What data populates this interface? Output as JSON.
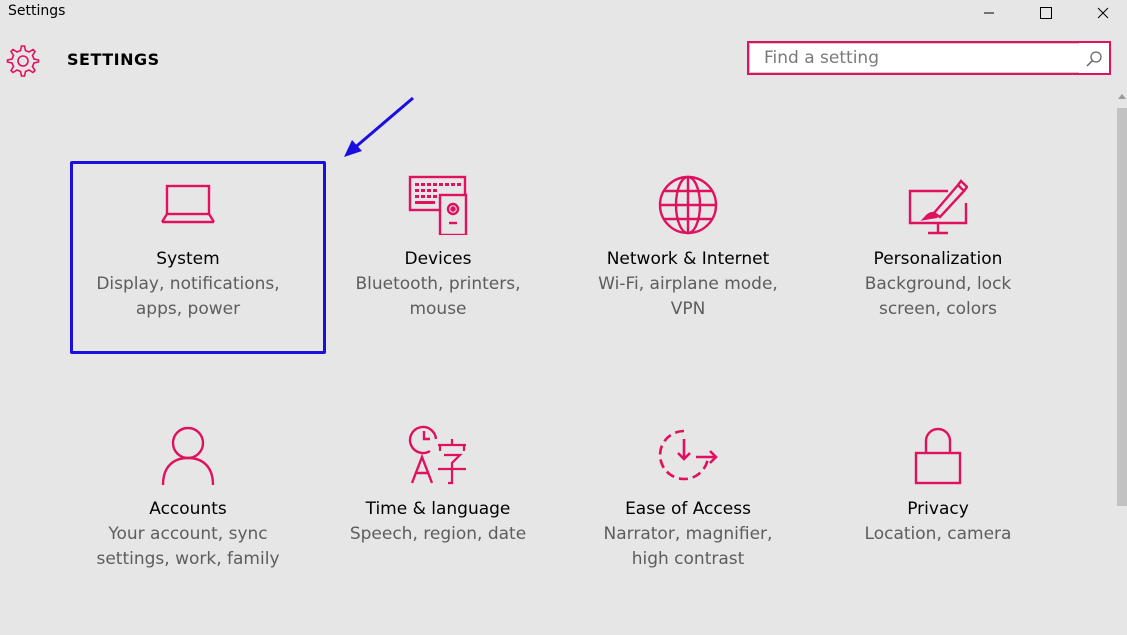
{
  "window": {
    "title": "Settings",
    "controls": [
      "minimize",
      "maximize",
      "close"
    ]
  },
  "header": {
    "title": "SETTINGS",
    "icon": "gear-icon"
  },
  "search": {
    "placeholder": "Find a setting",
    "value": ""
  },
  "colors": {
    "accent": "#e0115f",
    "highlight_border": "#1a0ee0",
    "background": "#e6e6e6"
  },
  "tiles": [
    {
      "icon": "laptop-icon",
      "title": "System",
      "description": [
        "Display, notifications,",
        "apps, power"
      ],
      "highlighted": true
    },
    {
      "icon": "keyboard-speaker-icon",
      "title": "Devices",
      "description": [
        "Bluetooth, printers,",
        "mouse"
      ]
    },
    {
      "icon": "globe-icon",
      "title": "Network & Internet",
      "description": [
        "Wi-Fi, airplane mode,",
        "VPN"
      ]
    },
    {
      "icon": "paint-monitor-icon",
      "title": "Personalization",
      "description": [
        "Background, lock",
        "screen, colors"
      ]
    },
    {
      "icon": "person-icon",
      "title": "Accounts",
      "description": [
        "Your account, sync",
        "settings, work, family"
      ]
    },
    {
      "icon": "clock-language-icon",
      "title": "Time & language",
      "description": [
        "Speech, region, date"
      ]
    },
    {
      "icon": "ease-of-access-icon",
      "title": "Ease of Access",
      "description": [
        "Narrator, magnifier,",
        "high contrast"
      ]
    },
    {
      "icon": "lock-icon",
      "title": "Privacy",
      "description": [
        "Location, camera"
      ]
    }
  ]
}
